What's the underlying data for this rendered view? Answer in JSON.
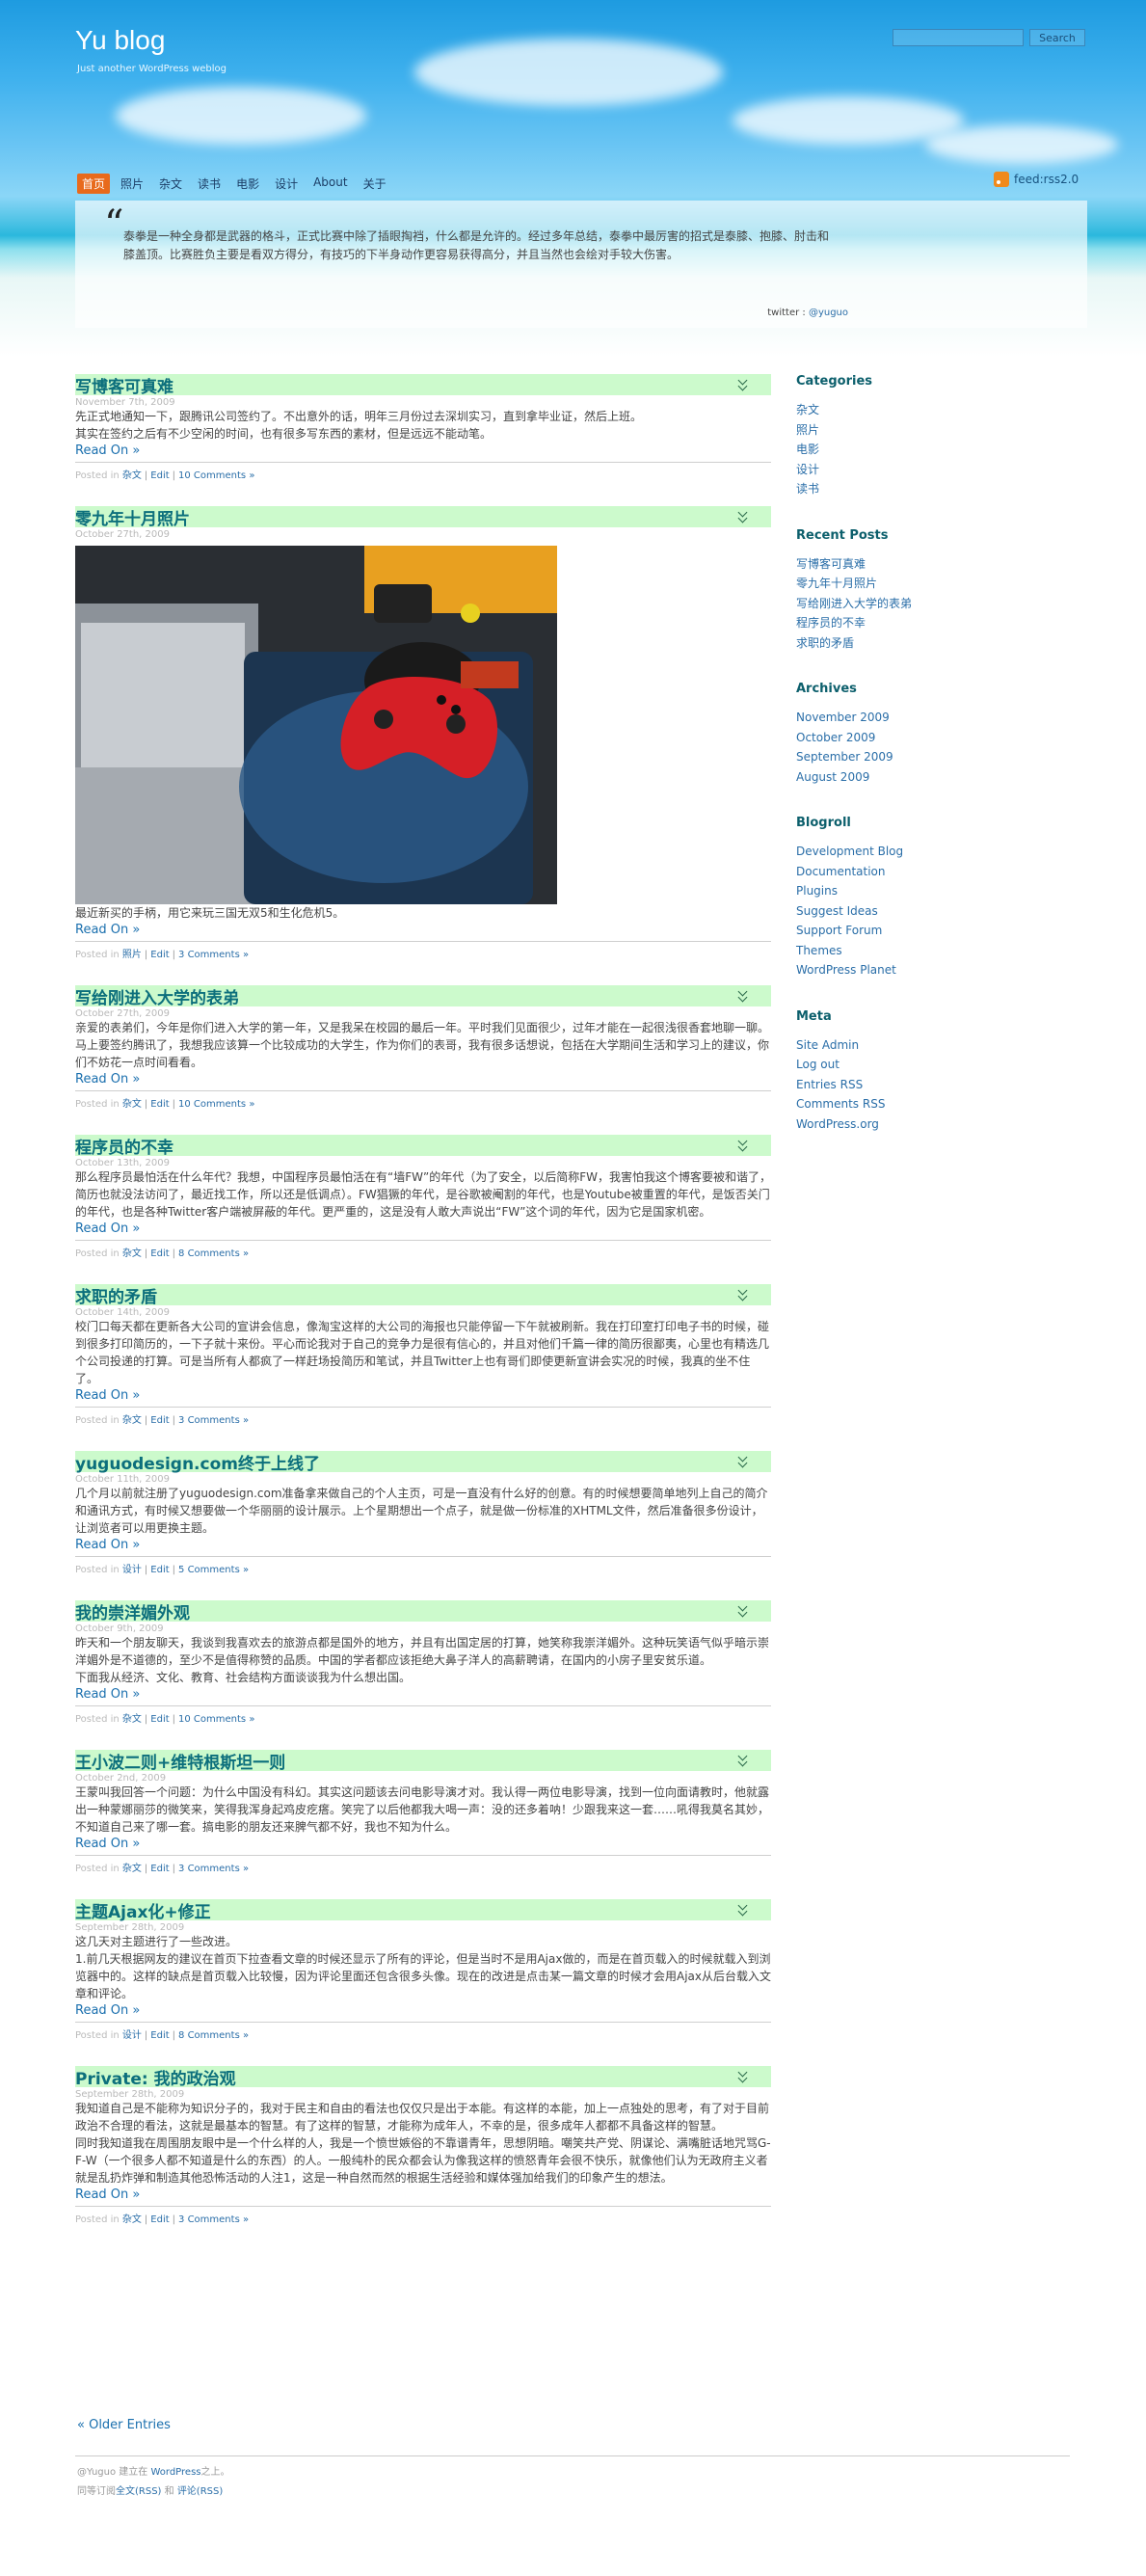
{
  "site": {
    "title": "Yu blog",
    "description": "Just another WordPress weblog"
  },
  "search": {
    "placeholder": "",
    "button": "Search"
  },
  "nav": [
    "首页",
    "照片",
    "杂文",
    "读书",
    "电影",
    "设计",
    "About",
    "关于"
  ],
  "feed_label": "feed:rss2.0",
  "quote": {
    "mark": "“",
    "text": "泰拳是一种全身都是武器的格斗，正式比赛中除了插眼掏裆，什么都是允许的。经过多年总结，泰拳中最厉害的招式是泰膝、抱膝、肘击和膝盖顶。比赛胜负主要是看双方得分，有技巧的下半身动作更容易获得高分，并且当然也会绘对手较大伤害。",
    "credit_prefix": "twitter : ",
    "credit_handle": "@yuguo"
  },
  "posts": [
    {
      "title": "写博客可真难",
      "date": "November 7th, 2009",
      "body": [
        "先正式地通知一下，跟腾讯公司签约了。不出意外的话，明年三月份过去深圳实习，直到拿毕业证，然后上班。",
        "其实在签约之后有不少空闲的时间，也有很多写东西的素材，但是远远不能动笔。"
      ],
      "read_on": "Read On »",
      "posted_in": "Posted in ",
      "category": "杂文",
      "edit": "Edit",
      "comments": "10 Comments »"
    },
    {
      "title": "零九年十月照片",
      "date": "October 27th, 2009",
      "has_photo": true,
      "body": [
        "最近新买的手柄，用它来玩三国无双5和生化危机5。"
      ],
      "read_on": "Read On »",
      "posted_in": "Posted in ",
      "category": "照片",
      "edit": "Edit",
      "comments": "3 Comments »"
    },
    {
      "title": "写给刚进入大学的表弟",
      "date": "October 27th, 2009",
      "body": [
        "亲爱的表弟们，今年是你们进入大学的第一年，又是我呆在校园的最后一年。平时我们见面很少，过年才能在一起很浅很香套地聊一聊。马上要签约腾讯了，我想我应该算一个比较成功的大学生，作为你们的表哥，我有很多话想说，包括在大学期间生活和学习上的建议，你们不妨花一点时间看看。"
      ],
      "read_on": "Read On »",
      "posted_in": "Posted in ",
      "category": "杂文",
      "edit": "Edit",
      "comments": "10 Comments »"
    },
    {
      "title": "程序员的不幸",
      "date": "October 13th, 2009",
      "body": [
        "那么程序员最怕活在什么年代？我想，中国程序员最怕活在有“墙FW”的年代（为了安全，以后简称FW，我害怕我这个博客要被和谐了，简历也就没法访问了，最近找工作，所以还是低调点）。FW猖獗的年代，是谷歌被阉割的年代，也是Youtube被重置的年代，是饭否关门的年代，也是各种Twitter客户端被屏蔽的年代。更严重的，这是没有人敢大声说出“FW”这个词的年代，因为它是国家机密。"
      ],
      "read_on": "Read On »",
      "posted_in": "Posted in ",
      "category": "杂文",
      "edit": "Edit",
      "comments": "8 Comments »"
    },
    {
      "title": "求职的矛盾",
      "date": "October 14th, 2009",
      "body": [
        "校门口每天都在更新各大公司的宣讲会信息，像淘宝这样的大公司的海报也只能停留一下午就被刷新。我在打印室打印电子书的时候，碰到很多打印简历的，一下子就十来份。平心而论我对于自己的竞争力是很有信心的，并且对他们千篇一律的简历很鄙夷，心里也有精选几个公司投递的打算。可是当所有人都疯了一样赶场投简历和笔试，并且Twitter上也有哥们即使更新宣讲会实况的时候，我真的坐不住了。"
      ],
      "read_on": "Read On »",
      "posted_in": "Posted in ",
      "category": "杂文",
      "edit": "Edit",
      "comments": "3 Comments »"
    },
    {
      "title": "yuguodesign.com终于上线了",
      "date": "October 11th, 2009",
      "body": [
        "几个月以前就注册了yuguodesign.com准备拿来做自己的个人主页，可是一直没有什么好的创意。有的时候想要简单地列上自己的简介和通讯方式，有时候又想要做一个华丽丽的设计展示。上个星期想出一个点子，就是做一份标准的XHTML文件，然后准备很多份设计，让浏览者可以用更换主题。"
      ],
      "read_on": "Read On »",
      "posted_in": "Posted in ",
      "category": "设计",
      "edit": "Edit",
      "comments": "5 Comments »"
    },
    {
      "title": "我的崇洋媚外观",
      "date": "October 9th, 2009",
      "body": [
        "昨天和一个朋友聊天，我谈到我喜欢去的旅游点都是国外的地方，并且有出国定居的打算，她笑称我崇洋媚外。这种玩笑语气似乎暗示崇洋媚外是不道德的，至少不是值得称赞的品质。中国的学者都应该拒绝大鼻子洋人的高薪聘请，在国内的小房子里安贫乐道。",
        "下面我从经济、文化、教育、社会结构方面谈谈我为什么想出国。"
      ],
      "read_on": "Read On »",
      "posted_in": "Posted in ",
      "category": "杂文",
      "edit": "Edit",
      "comments": "10 Comments »"
    },
    {
      "title": "王小波二则+维特根斯坦一则",
      "date": "October 2nd, 2009",
      "body": [
        "王蒙叫我回答一个问题：为什么中国没有科幻。其实这问题该去问电影导演才对。我认得一两位电影导演，找到一位向面请教时，他就露出一种蒙娜丽莎的微笑来，笑得我浑身起鸡皮疙瘩。笑完了以后他都我大喝一声：没的还多着呐！少跟我来这一套……吼得我莫名其妙，不知道自己来了哪一套。搞电影的朋友还来脾气都不好，我也不知为什么。"
      ],
      "read_on": "Read On »",
      "posted_in": "Posted in ",
      "category": "杂文",
      "edit": "Edit",
      "comments": "3 Comments »"
    },
    {
      "title": "主题Ajax化+修正",
      "date": "September 28th, 2009",
      "body": [
        "这几天对主题进行了一些改进。",
        "1.前几天根据网友的建议在首页下拉查看文章的时候还显示了所有的评论，但是当时不是用Ajax做的，而是在首页载入的时候就载入到浏览器中的。这样的缺点是首页载入比较慢，因为评论里面还包含很多头像。现在的改进是点击某一篇文章的时候才会用Ajax从后台载入文章和评论。"
      ],
      "read_on": "Read On »",
      "posted_in": "Posted in ",
      "category": "设计",
      "edit": "Edit",
      "comments": "8 Comments »"
    },
    {
      "title": "Private: 我的政治观",
      "date": "September 28th, 2009",
      "body": [
        "我知道自己是不能称为知识分子的，我对于民主和自由的看法也仅仅只是出于本能。有这样的本能，加上一点独处的思考，有了对于目前政治不合理的看法，这就是最基本的智慧。有了这样的智慧，才能称为成年人，不幸的是，很多成年人都都不具备这样的智慧。",
        "同时我知道我在周围朋友眼中是一个什么样的人，我是一个愤世嫉俗的不靠谱青年，思想阴暗。嘲笑共产党、阴谋论、满嘴脏话地咒骂G-F-W（一个很多人都不知道是什么的东西）的人。一般纯朴的民众都会认为像我这样的愤怒青年会很不快乐，就像他们认为无政府主义者就是乱扔炸弹和制造其他恐怖活动的人注1，这是一种自然而然的根据生活经验和媒体强加给我们的印象产生的想法。"
      ],
      "read_on": "Read On »",
      "posted_in": "Posted in ",
      "category": "杂文",
      "edit": "Edit",
      "comments": "3 Comments »"
    }
  ],
  "older_entries": "« Older Entries",
  "sidebar": {
    "categories": {
      "title": "Categories",
      "items": [
        "杂文",
        "照片",
        "电影",
        "设计",
        "读书"
      ]
    },
    "recent": {
      "title": "Recent Posts",
      "items": [
        "写博客可真难",
        "零九年十月照片",
        "写给刚进入大学的表弟",
        "程序员的不幸",
        "求职的矛盾"
      ]
    },
    "archives": {
      "title": "Archives",
      "items": [
        "November 2009",
        "October 2009",
        "September 2009",
        "August 2009"
      ]
    },
    "blogroll": {
      "title": "Blogroll",
      "items": [
        "Development Blog",
        "Documentation",
        "Plugins",
        "Suggest Ideas",
        "Support Forum",
        "Themes",
        "WordPress Planet"
      ]
    },
    "meta": {
      "title": "Meta",
      "items": [
        "Site Admin",
        "Log out",
        "Entries RSS",
        "Comments RSS",
        "WordPress.org"
      ]
    }
  },
  "footer": {
    "line1_prefix": "@Yuguo 建立在 ",
    "line1_link": "WordPress",
    "line1_suffix": "之上。",
    "line2_prefix": "同等订阅",
    "line2_link1": "全文(RSS)",
    "line2_mid": " 和 ",
    "line2_link2": "评论(RSS)"
  },
  "colors": {
    "nav_active": "#e86a1c",
    "post_header_bg": "#ccfacc",
    "post_title": "#0c6f7c",
    "link": "#2a6ea8"
  }
}
